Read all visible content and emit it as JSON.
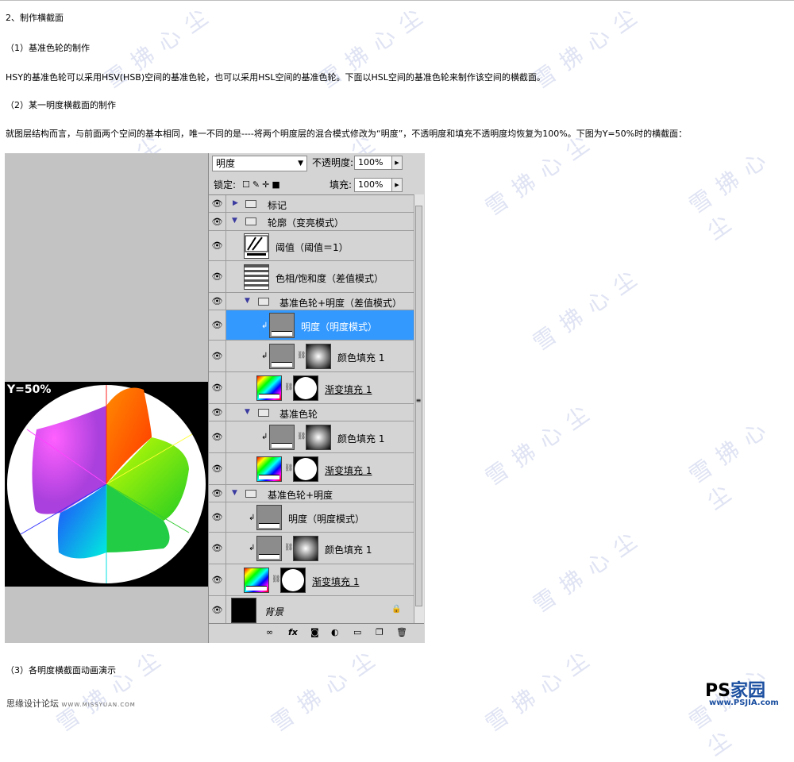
{
  "article": {
    "section": "2、制作横截面",
    "sub1": "（1）基准色轮的制作",
    "para1": "HSY的基准色轮可以采用HSV(HSB)空间的基准色轮，也可以采用HSL空间的基准色轮。下面以HSL空间的基准色轮来制作该空间的横截面。",
    "sub2": "（2）某一明度横截面的制作",
    "para2": "就图层结构而言，与前面两个空间的基本相同，唯一不同的是----将两个明度层的混合模式修改为“明度”，不透明度和填充不透明度均恢复为100%。下图为Y=50%时的横截面：",
    "sub3": "（3）各明度横截面动画演示"
  },
  "preview": {
    "label": "Y=50%"
  },
  "panel": {
    "blend_mode": "明度",
    "opacity_label": "不透明度:",
    "opacity_value": "100%",
    "lock_label": "锁定:",
    "fill_label": "填充:",
    "fill_value": "100%"
  },
  "layers": [
    {
      "name": "标记"
    },
    {
      "name": "轮廓（变亮模式）"
    },
    {
      "name": "阈值（阈值＝1）"
    },
    {
      "name": "色相/饱和度（差值模式）"
    },
    {
      "name": "基准色轮+明度（差值模式）"
    },
    {
      "name": "明度（明度模式）"
    },
    {
      "name": "颜色填充 1"
    },
    {
      "name": "渐变填充 1"
    },
    {
      "name": "基准色轮"
    },
    {
      "name": "颜色填充 1"
    },
    {
      "name": "渐变填充 1"
    },
    {
      "name": "基准色轮+明度"
    },
    {
      "name": "明度（明度模式）"
    },
    {
      "name": "颜色填充 1"
    },
    {
      "name": "渐变填充 1"
    },
    {
      "name": "背景"
    }
  ],
  "watermark": "雪 拂 心 尘",
  "footer": {
    "forum": "思缘设计论坛",
    "forum_url": "WWW.MISSYUAN.COM",
    "logo_ps": "PS",
    "logo_jia": "家园",
    "logo_url": "www.PSJIA.com"
  }
}
